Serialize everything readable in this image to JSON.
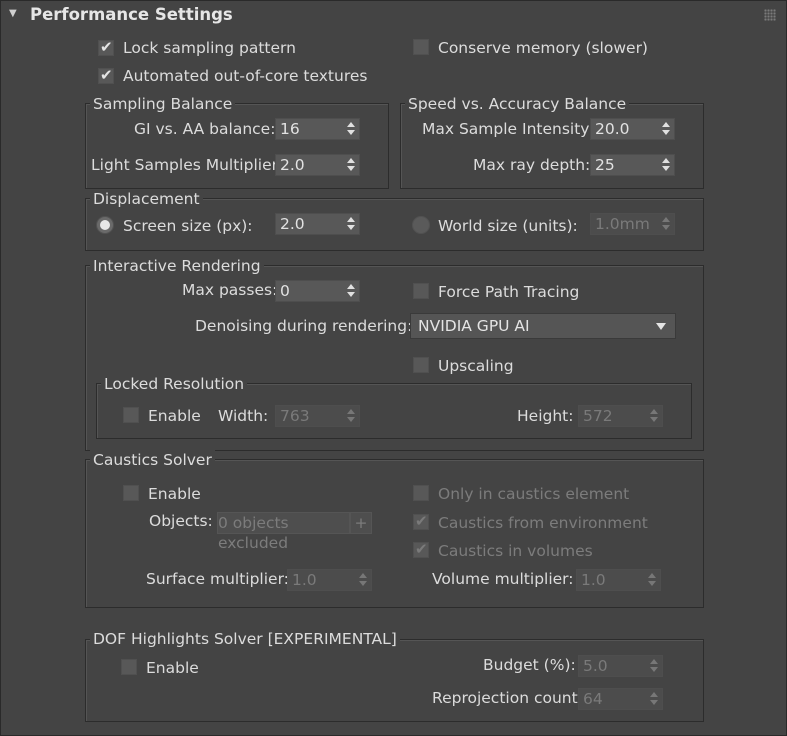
{
  "header": {
    "title": "Performance Settings"
  },
  "top": {
    "lock_sampling": {
      "label": "Lock sampling pattern",
      "checked": true
    },
    "automated_ooc": {
      "label": "Automated out-of-core textures",
      "checked": true
    },
    "conserve_memory": {
      "label": "Conserve memory (slower)",
      "checked": false
    }
  },
  "sampling_balance": {
    "title": "Sampling Balance",
    "gi_aa_label": "GI vs. AA balance:",
    "gi_aa_value": "16",
    "light_samples_label": "Light Samples Multiplier:",
    "light_samples_value": "2.0"
  },
  "speed_accuracy": {
    "title": "Speed vs. Accuracy Balance",
    "max_sample_label": "Max Sample Intensity:",
    "max_sample_value": "20.0",
    "max_ray_label": "Max ray depth:",
    "max_ray_value": "25"
  },
  "displacement": {
    "title": "Displacement",
    "screen_label": "Screen size (px):",
    "screen_value": "2.0",
    "world_label": "World size (units):",
    "world_value": "1.0mm"
  },
  "interactive": {
    "title": "Interactive Rendering",
    "max_passes_label": "Max passes:",
    "max_passes_value": "0",
    "force_path_label": "Force Path Tracing",
    "denoise_label": "Denoising during rendering:",
    "denoise_value": "NVIDIA GPU AI",
    "upscaling_label": "Upscaling",
    "locked": {
      "title": "Locked Resolution",
      "enable_label": "Enable",
      "width_label": "Width:",
      "width_value": "763",
      "height_label": "Height:",
      "height_value": "572"
    }
  },
  "caustics": {
    "title": "Caustics Solver",
    "enable_label": "Enable",
    "objects_label": "Objects:",
    "objects_value": "0 objects excluded",
    "plus": "+",
    "only_caustics_label": "Only in caustics element",
    "from_env_label": "Caustics from environment",
    "in_volumes_label": "Caustics in volumes",
    "surface_label": "Surface multiplier:",
    "surface_value": "1.0",
    "volume_label": "Volume multiplier:",
    "volume_value": "1.0"
  },
  "dof": {
    "title": "DOF Highlights Solver [EXPERIMENTAL]",
    "enable_label": "Enable",
    "budget_label": "Budget (%):",
    "budget_value": "5.0",
    "reproj_label": "Reprojection count:",
    "reproj_value": "64"
  },
  "icons": {
    "collapse": "▼",
    "check": "✔"
  }
}
